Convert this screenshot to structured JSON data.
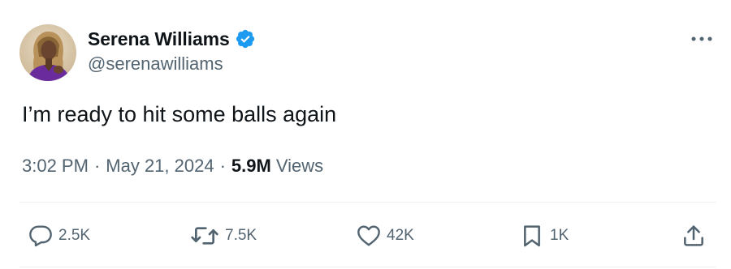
{
  "author": {
    "display_name": "Serena Williams",
    "handle": "@serenawilliams",
    "verified": true,
    "verified_color": "#1d9bf0"
  },
  "tweet": {
    "text": "I’m ready to hit some balls again",
    "time": "3:02 PM",
    "separator": "·",
    "date": "May 21, 2024",
    "views_count": "5.9M",
    "views_label": "Views"
  },
  "actions": {
    "reply": {
      "icon": "reply-icon",
      "count": "2.5K"
    },
    "retweet": {
      "icon": "retweet-icon",
      "count": "7.5K"
    },
    "like": {
      "icon": "heart-icon",
      "count": "42K"
    },
    "bookmark": {
      "icon": "bookmark-icon",
      "count": "1K"
    },
    "share": {
      "icon": "share-icon"
    }
  },
  "colors": {
    "text_primary": "#0f1419",
    "text_secondary": "#536471",
    "divider": "#eff3f4"
  }
}
